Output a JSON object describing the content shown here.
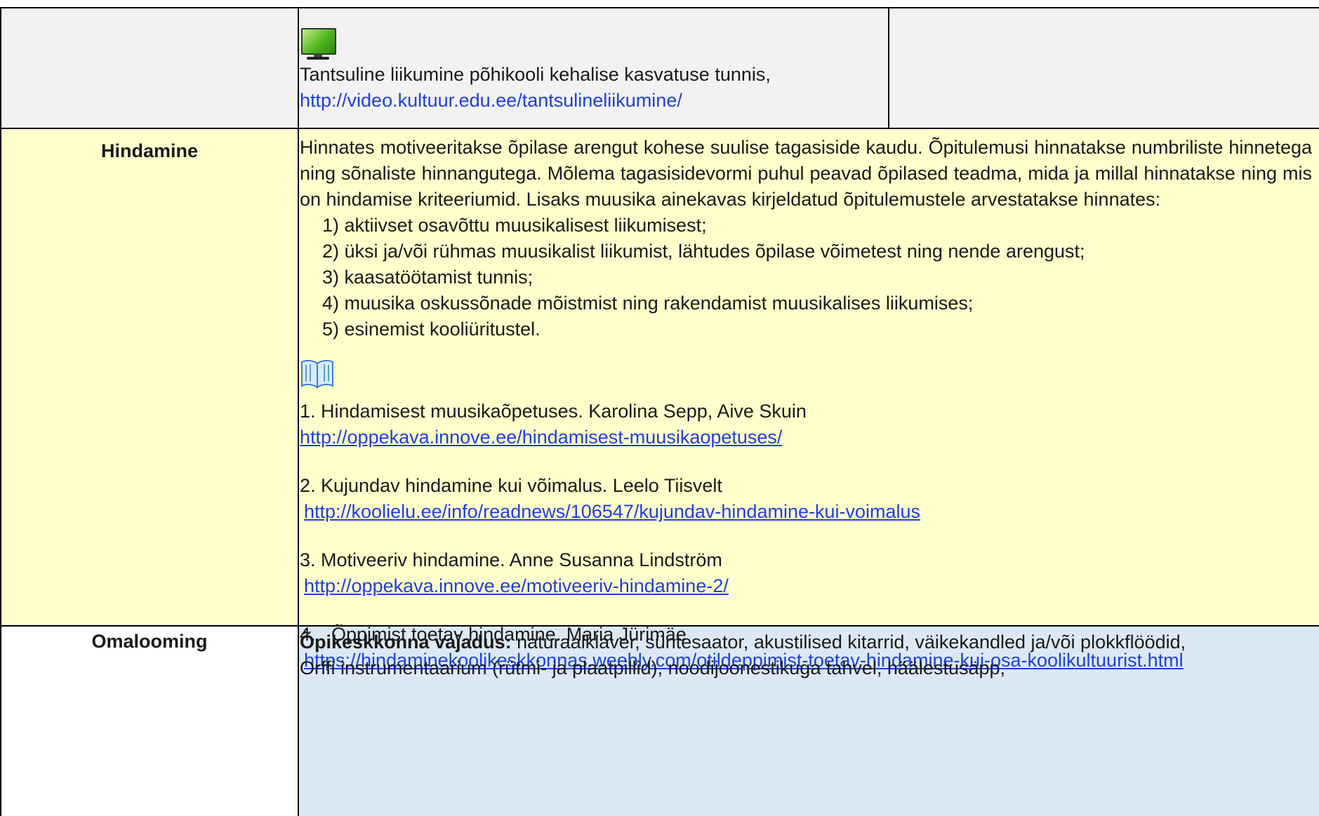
{
  "top_row": {
    "label": "",
    "icon": "monitor-icon",
    "text": "Tantsuline liikumine põhikooli kehalise kasvatuse tunnis,",
    "link": "http://video.kultuur.edu.ee/tantsulineliikumine/"
  },
  "hindamine": {
    "label": "Hindamine",
    "paragraph": "Hinnates motiveeritakse õpilase arengut kohese suulise tagasiside kaudu. Õpitulemusi hinnatakse numbriliste hinnetega ning sõnaliste hinnangutega. Mõlema tagasisidevormi puhul peavad õpilased teadma, mida ja millal hinnatakse ning mis on hindamise kriteeriumid. Lisaks muusika ainekavas kirjeldatud õpitulemustele arvestatakse hinnates:",
    "list": [
      "1) aktiivset osavõttu muusikalisest liikumisest;",
      "2) üksi ja/või rühmas muusikalist liikumist, lähtudes õpilase võimetest ning nende arengust;",
      "3) kaasatöötamist tunnis;",
      "4) muusika oskussõnade mõistmist ning rakendamist muusikalises liikumises;",
      "5) esinemist kooliüritustel."
    ],
    "book_icon": "book-icon",
    "resources": [
      {
        "title": "1. Hindamisest muusikaõpetuses. Karolina Sepp, Aive Skuin",
        "url": "http://oppekava.innove.ee/hindamisest-muusikaopetuses/"
      },
      {
        "title": "2. Kujundav hindamine kui võimalus. Leelo Tiisvelt",
        "url": "http://koolielu.ee/info/readnews/106547/kujundav-hindamine-kui-voimalus"
      },
      {
        "title": "3. Motiveeriv hindamine. Anne Susanna Lindström",
        "url": "http://oppekava.innove.ee/motiveeriv-hindamine-2/"
      },
      {
        "title": "4.   Õppimist toetav hindamine. Maria Jürimäe",
        "url": "https://hindaminekoolikeskkonnas.weebly.com/otildeppimist-toetav-hindamine-kui-osa-koolikultuurist.html"
      }
    ]
  },
  "omalooming": {
    "label": "Omalooming",
    "bold_lead": "Õpikeskkonna vajadus:",
    "line1_rest": " naturaalklaver, süntesaator, akustilised kitarrid, väikekandled ja/või plokkflöödid,",
    "line2": "Orffi instrumentaarium (rütmi- ja plaatpillid), noodijoonestikuga tahvel, häälestusäpp,"
  }
}
